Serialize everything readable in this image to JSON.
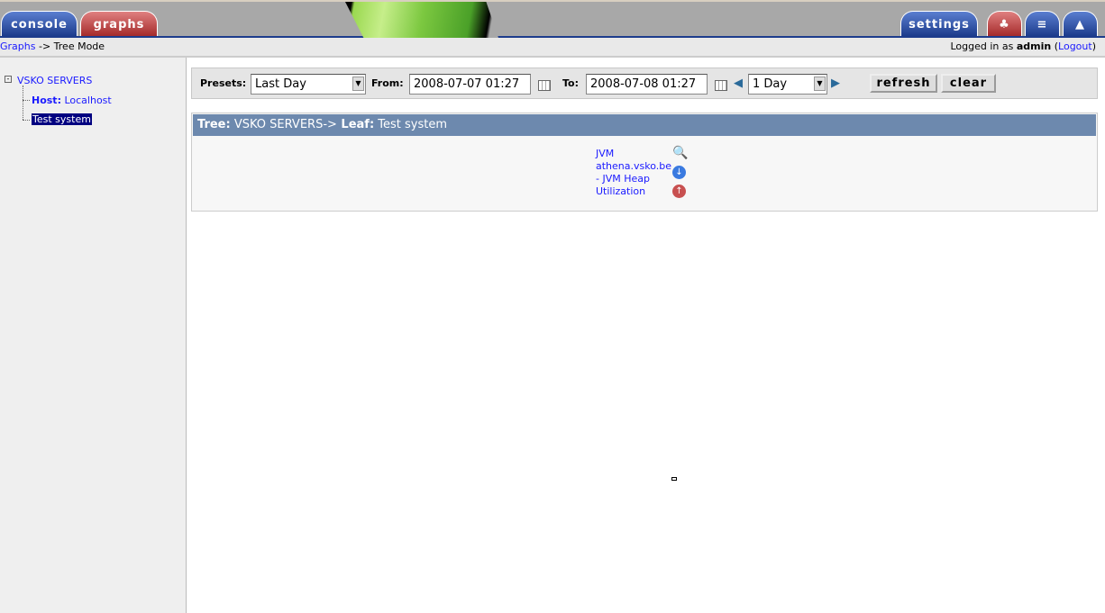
{
  "nav": {
    "console": "console",
    "graphs": "graphs",
    "settings": "settings",
    "tree_icon": "tree-icon",
    "list_icon": "list-icon",
    "preview_icon": "preview-icon"
  },
  "breadcrumb": {
    "link": "Graphs",
    "rest": " -> Tree Mode"
  },
  "login": {
    "prefix": "Logged in as ",
    "user": "admin",
    "open": " (",
    "logout": "Logout",
    "close": ")"
  },
  "tree": {
    "root": "VSKO SERVERS",
    "host_label": "Host:",
    "host": "Localhost",
    "selected": "Test system"
  },
  "filter": {
    "presets_label": "Presets:",
    "preset": "Last Day",
    "from_label": "From:",
    "from": "2008-07-07 01:27",
    "to_label": "To:",
    "to": "2008-07-08 01:27",
    "span": "1 Day",
    "refresh": "refresh",
    "clear": "clear"
  },
  "panel": {
    "tree_label": "Tree:",
    "tree_value": " VSKO SERVERS->",
    "leaf_label": " Leaf:",
    "leaf_value": " Test system",
    "graph_lines": [
      "JVM",
      "athena.vsko.be",
      "- JVM Heap",
      "Utilization"
    ]
  }
}
